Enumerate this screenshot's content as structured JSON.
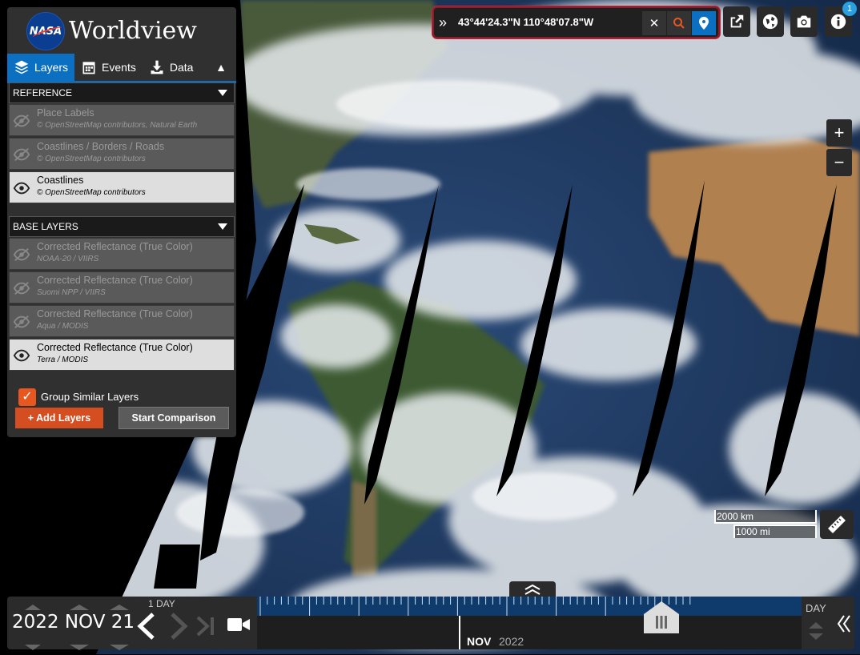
{
  "app": {
    "title": "Worldview",
    "logo_text": "NASA"
  },
  "tabs": [
    {
      "label": "Layers",
      "icon": "layers-icon",
      "active": true
    },
    {
      "label": "Events",
      "icon": "calendar-icon",
      "active": false
    },
    {
      "label": "Data",
      "icon": "download-icon",
      "active": false
    }
  ],
  "reference": {
    "title": "REFERENCE",
    "layers": [
      {
        "name": "Place Labels",
        "source": "© OpenStreetMap contributors, Natural Earth",
        "visible": false
      },
      {
        "name": "Coastlines / Borders / Roads",
        "source": "© OpenStreetMap contributors",
        "visible": false
      },
      {
        "name": "Coastlines",
        "source": "© OpenStreetMap contributors",
        "visible": true
      }
    ]
  },
  "base": {
    "title": "BASE LAYERS",
    "layers": [
      {
        "name": "Corrected Reflectance (True Color)",
        "source": "NOAA-20 / VIIRS",
        "visible": false
      },
      {
        "name": "Corrected Reflectance (True Color)",
        "source": "Suomi NPP / VIIRS",
        "visible": false
      },
      {
        "name": "Corrected Reflectance (True Color)",
        "source": "Aqua / MODIS",
        "visible": false
      },
      {
        "name": "Corrected Reflectance (True Color)",
        "source": "Terra / MODIS",
        "visible": true
      }
    ]
  },
  "group_similar": {
    "label": "Group Similar Layers",
    "checked": true
  },
  "buttons": {
    "add_layers": "+ Add Layers",
    "start_comparison": "Start Comparison"
  },
  "coordinates": {
    "text": "43°44'24.3\"N 110°48'07.8\"W"
  },
  "scale": {
    "km": "2000 km",
    "mi": "1000 mi"
  },
  "timeline": {
    "date": "2022 NOV 21",
    "interval": "1 DAY",
    "zoom_unit": "DAY",
    "month": "NOV",
    "year": "2022"
  },
  "info_badge": "1",
  "colors": {
    "accent": "#0b6fc2",
    "add_button": "#d54e21",
    "coord_border": "#8b1a2a"
  }
}
